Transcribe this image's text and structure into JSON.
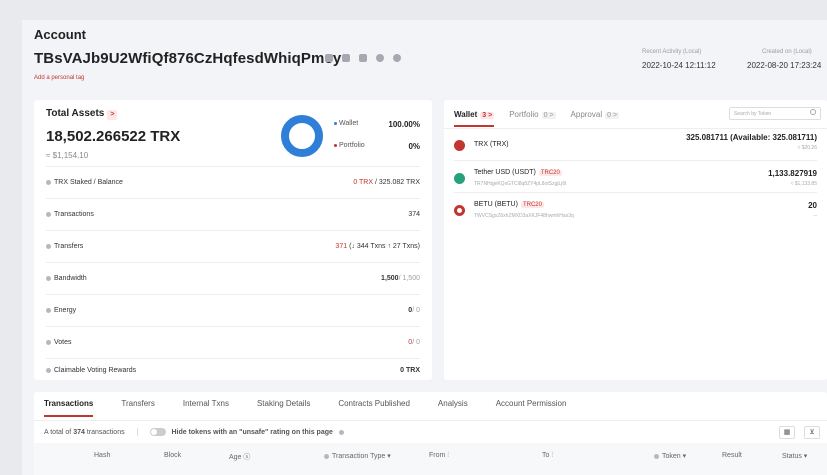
{
  "header": {
    "title": "Account",
    "address": "TBsVAJb9U2WfiQf876CzHqfesdWhiqPmey",
    "add_tag": "Add a personal tag",
    "recent_activity_label": "Recent Activity (Local)",
    "recent_activity_value": "2022-10-24 12:11:12",
    "created_on_label": "Created on (Local)",
    "created_on_value": "2022-08-20 17:23:24"
  },
  "assets": {
    "title": "Total Assets",
    "amount": "18,502.266522 TRX",
    "usd": "≈ $1,154.10",
    "legend": [
      {
        "label": "Wallet",
        "pct": "100.00%",
        "color": "#2f7fd8"
      },
      {
        "label": "Portfolio",
        "pct": "0%",
        "color": "#c23631"
      }
    ],
    "donut_color": "#2f7fd8",
    "rows": [
      {
        "label": "TRX Staked / Balance",
        "v1": "0 TRX",
        "v2": "/ 325.082 TRX"
      },
      {
        "label": "Transactions",
        "v1": "374"
      },
      {
        "label": "Transfers",
        "v1": "371",
        "v2": "(↓ 344 Txns ↑ 27 Txns)"
      },
      {
        "label": "Bandwidth",
        "v1": "1,500",
        "v2": "/ 1,500"
      },
      {
        "label": "Energy",
        "v1": "0",
        "v2": "/ 0"
      },
      {
        "label": "Votes",
        "v1": "0",
        "v2": "/ 0"
      },
      {
        "label": "Claimable Voting Rewards",
        "v1": "0 TRX"
      }
    ]
  },
  "wallet": {
    "tabs": [
      {
        "label": "Wallet",
        "badge": "3"
      },
      {
        "label": "Portfolio",
        "badge": "0"
      },
      {
        "label": "Approval",
        "badge": "0"
      }
    ],
    "search_placeholder": "Search by Token",
    "tokens": [
      {
        "name": "TRX (TRX)",
        "tag": "",
        "addr": "",
        "balance": "325.081711 (Available: 325.081711)",
        "usd": "≈ $20.26",
        "color": "#c23631"
      },
      {
        "name": "Tether USD (USDT)",
        "tag": "TRC20",
        "addr": "TR7NHqjeKQxGTCi8q8ZY4pL8otSzgjLj6t",
        "balance": "1,133.827919",
        "usd": "≈ $1,133.85",
        "color": "#26a17b"
      },
      {
        "name": "BETU (BETU)",
        "tag": "TRC20",
        "addr": "TWVCSgxZ6xhZMXD3aXKJF48hwmhHas3q",
        "balance": "20",
        "usd": "--",
        "color": "#c23631"
      }
    ]
  },
  "transactions": {
    "tabs": [
      "Transactions",
      "Transfers",
      "Internal Txns",
      "Staking Details",
      "Contracts Published",
      "Analysis",
      "Account Permission"
    ],
    "total_prefix": "A total of",
    "total_count": "374",
    "total_suffix": "transactions",
    "hide_label": "Hide tokens with an \"unsafe\" rating on this page",
    "columns": [
      "Hash",
      "Block",
      "Age",
      "Transaction Type",
      "From",
      "To",
      "Token",
      "Result",
      "Status"
    ]
  }
}
